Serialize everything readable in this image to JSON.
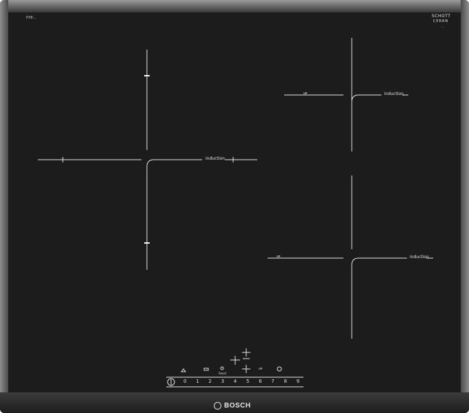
{
  "model_label": "PXE...",
  "logo": {
    "line1": "SCHOTT",
    "line2": "CERAN",
    "sub": "..."
  },
  "zones": {
    "left": {
      "label": "induction"
    },
    "top_right": {
      "label": "induction",
      "boost": "ᴜᴘ"
    },
    "bottom_right": {
      "label": "induction",
      "boost": "ᴜᴘ"
    }
  },
  "controls": {
    "keep_warm_icon": "hand-icon",
    "frying_icon": "pan-icon",
    "reset_label": "Reset",
    "boost_label": "ᴜᴘ",
    "timer_icon": "clock-icon",
    "power_icon": "power-icon",
    "scale_digits": [
      "0",
      "1",
      "2",
      "3",
      "4",
      "5",
      "6",
      "7",
      "8",
      "9"
    ],
    "scale_sub": [
      "",
      "",
      "",
      "",
      "·",
      "",
      "",
      "",
      "",
      ""
    ]
  },
  "brand": {
    "name": "BOSCH"
  },
  "colors": {
    "glass": "#1d1c1c",
    "marking": "#e8e8e8",
    "frame": "#6e6e6e"
  }
}
